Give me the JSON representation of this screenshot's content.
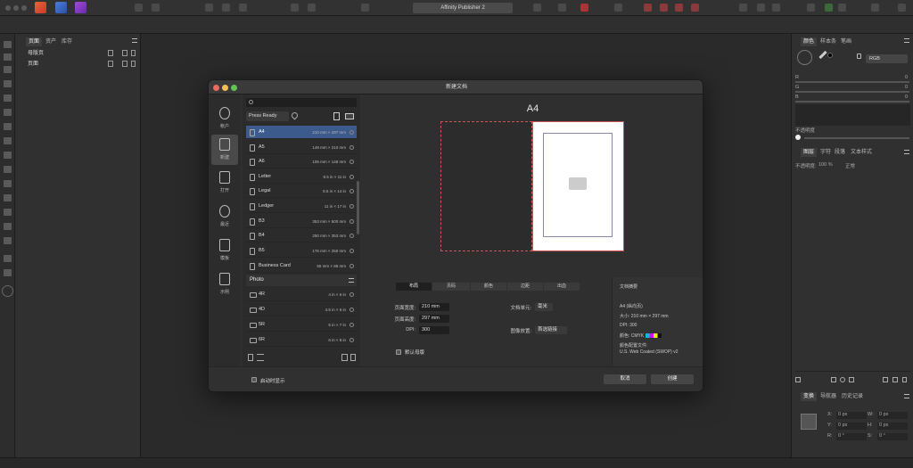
{
  "app": {
    "title": "Affinity Publisher 2"
  },
  "pages_panel": {
    "tabs": [
      "页面",
      "资产",
      "库存"
    ],
    "rows": [
      "母版页",
      "页面"
    ]
  },
  "right_panel": {
    "top_tabs": [
      "颜色",
      "样本条",
      "笔画"
    ],
    "color_model": "RGB",
    "channels": [
      {
        "label": "R",
        "value": "0"
      },
      {
        "label": "G",
        "value": "0"
      },
      {
        "label": "B",
        "value": "0"
      }
    ],
    "opacity_label": "不透明度",
    "mid_tabs": [
      "图层",
      "字符",
      "段落",
      "文本样式"
    ],
    "layer_opacity_label": "不透明度:",
    "layer_opacity_value": "100 %",
    "blend_mode": "正常",
    "bottom_tabs": [
      "变换",
      "导航器",
      "历史记录"
    ],
    "transform": [
      {
        "label": "X:",
        "value": "0 px"
      },
      {
        "label": "W:",
        "value": "0 px"
      },
      {
        "label": "Y:",
        "value": "0 px"
      },
      {
        "label": "H:",
        "value": "0 px"
      },
      {
        "label": "R:",
        "value": "0 °"
      },
      {
        "label": "S:",
        "value": "0 °"
      }
    ]
  },
  "dialog": {
    "title": "新建文档",
    "nav": [
      {
        "label": "帐户",
        "icon": "account-icon"
      },
      {
        "label": "新建",
        "icon": "new-document-icon"
      },
      {
        "label": "打开",
        "icon": "open-folder-icon"
      },
      {
        "label": "最近",
        "icon": "recent-icon"
      },
      {
        "label": "模板",
        "icon": "template-icon"
      },
      {
        "label": "示例",
        "icon": "samples-icon"
      }
    ],
    "preset_category": "Press Ready",
    "presets": [
      {
        "name": "A4",
        "size": "210 mm × 297 mm"
      },
      {
        "name": "A5",
        "size": "148 mm × 210 mm"
      },
      {
        "name": "A6",
        "size": "105 mm × 148 mm"
      },
      {
        "name": "Letter",
        "size": "8.5 in × 11 in"
      },
      {
        "name": "Legal",
        "size": "8.5 in × 14 in"
      },
      {
        "name": "Ledger",
        "size": "11 in × 17 in"
      },
      {
        "name": "B3",
        "size": "353 mm × 500 mm"
      },
      {
        "name": "B4",
        "size": "250 mm × 353 mm"
      },
      {
        "name": "B5",
        "size": "176 mm × 250 mm"
      },
      {
        "name": "Business Card",
        "size": "55 mm × 86 mm"
      }
    ],
    "photo_group": "Photo",
    "photo_presets": [
      {
        "name": "4R",
        "size": "4 in × 6 in"
      },
      {
        "name": "4D",
        "size": "4.5 in × 6 in"
      },
      {
        "name": "5R",
        "size": "5 in × 7 in"
      },
      {
        "name": "6R",
        "size": "6 in × 8 in"
      }
    ],
    "preview_title": "A4",
    "setting_tabs": [
      "布局",
      "页码",
      "颜色",
      "边距",
      "出血"
    ],
    "fields": {
      "page_width_label": "页面宽度:",
      "page_width": "210 mm",
      "page_height_label": "页面高度:",
      "page_height": "297 mm",
      "dpi_label": "DPI:",
      "dpi": "300",
      "doc_units_label": "文档单元:",
      "doc_units": "毫米",
      "image_placement_label": "图像放置:",
      "image_placement": "首选链接",
      "default_master_label": "默认母版"
    },
    "summary": {
      "title": "文档摘要",
      "lines": [
        "A4 (纵向页)",
        "大小: 210 mm × 297 mm",
        "DPI: 300",
        "颜色: CMYK",
        "颜色配置文件:",
        "U.S. Web Coated (SWOP) v2"
      ]
    },
    "footer": {
      "show_on_start": "启动时显示",
      "cancel": "取消",
      "create": "创建"
    }
  }
}
